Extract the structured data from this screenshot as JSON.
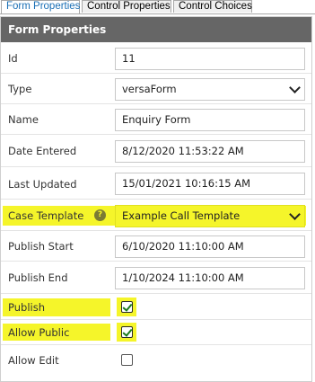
{
  "tabs": [
    {
      "label": "Form Properties",
      "active": true
    },
    {
      "label": "Control Properties",
      "active": false
    },
    {
      "label": "Control Choices",
      "active": false
    }
  ],
  "panel": {
    "header": "Form Properties"
  },
  "fields": {
    "id": {
      "label": "Id",
      "value": "11"
    },
    "type": {
      "label": "Type",
      "value": "versaForm"
    },
    "name": {
      "label": "Name",
      "value": "Enquiry Form"
    },
    "date_entered": {
      "label": "Date Entered",
      "value": "8/12/2020 11:53:22 AM"
    },
    "last_updated": {
      "label": "Last Updated",
      "value": "15/01/2021 10:16:15 AM"
    },
    "case_template": {
      "label": "Case Template",
      "value": "Example Call Template",
      "help_glyph": "?"
    },
    "publish_start": {
      "label": "Publish Start",
      "value": "6/10/2020 11:10:00 AM"
    },
    "publish_end": {
      "label": "Publish End",
      "value": "1/10/2024 11:10:00 AM"
    },
    "publish": {
      "label": "Publish",
      "checked": true
    },
    "allow_public": {
      "label": "Allow Public",
      "checked": true
    },
    "allow_edit": {
      "label": "Allow Edit",
      "checked": false
    }
  },
  "colors": {
    "highlight": "#f5f52a",
    "header_bg": "#666666",
    "active_tab_text": "#1a6fb5",
    "check": "#1a7a1a"
  },
  "icons": {
    "type_select": "chevron-down-icon",
    "case_template_select": "chevron-down-icon",
    "help": "help-icon",
    "check": "check-icon"
  }
}
